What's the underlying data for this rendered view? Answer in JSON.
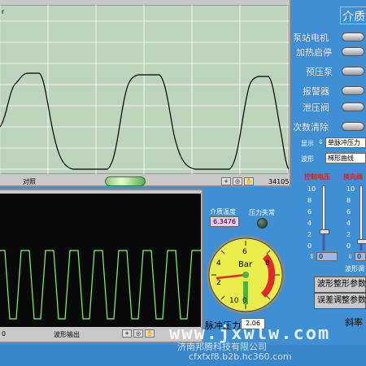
{
  "top_graph": {
    "corner_label": "r",
    "bottom_label": "对照",
    "right_value": "34105"
  },
  "bottom_graph": {
    "left_value": "0",
    "bottom_label": "波形输出"
  },
  "right_panel": {
    "header": "介质",
    "buttons": [
      {
        "label": "泵站电机"
      },
      {
        "label": "加热启停"
      },
      {
        "label": "预压泵"
      },
      {
        "label": "报警器"
      },
      {
        "label": "泄压阀"
      },
      {
        "label": "次数清除"
      }
    ],
    "display_label": "显示",
    "display_value": "单脉冲压力",
    "waveform_label": "波形",
    "waveform_value": "梯形曲线",
    "control_voltage_label": "控制电压",
    "reverse_valve_label": "换向阀",
    "slider_ticks": [
      "10",
      "8",
      "6",
      "4",
      "2",
      "0"
    ],
    "slider_value_left": "0",
    "slider_value_right": "0",
    "waveform_adjust_label": "波形调",
    "btn_wave_shaping": "波形整形参数",
    "btn_error_adjust": "误差调整参数",
    "slope_label": "斜率",
    "slider_left_level": 0.3,
    "slider_right_level": 0.15
  },
  "gauge": {
    "medium_temp_label": "介质温度",
    "medium_temp_value": "6.3476",
    "pressure_loss_label": "压力失常",
    "unit": "Bar",
    "ticks": [
      "0",
      "2",
      "4",
      "6",
      "8",
      "10"
    ],
    "pulse_pressure_label": "脉冲压力",
    "pulse_pressure_value": "2.06"
  },
  "watermark": {
    "url": "www.jxwlw.com",
    "company": "济南邦腾科技有限公司",
    "site": "cfxfxf8.b2b.hc360.com"
  },
  "colors": {
    "background": "#3f8fd4",
    "top_plot_bg": "#bcd4bc",
    "top_trace": "#000000",
    "bottom_trace": "#7cff5a",
    "panel_frame": "#c9c9c9",
    "gauge_face": "#e9ec4a",
    "gauge_red": "#e0292c",
    "gauge_green": "#3fb84a",
    "display_pink": "#f6c7f5"
  }
}
